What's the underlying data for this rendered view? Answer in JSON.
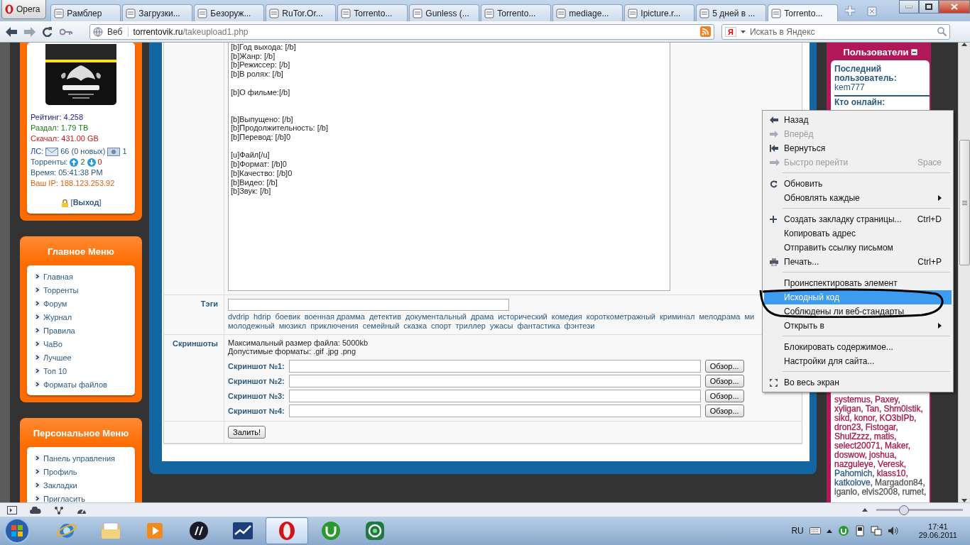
{
  "browser": {
    "opera_button": "Opera",
    "tabs": [
      {
        "title": "Рамблер",
        "selected": false
      },
      {
        "title": "Загрузки...",
        "selected": false
      },
      {
        "title": "Безоруж...",
        "selected": false
      },
      {
        "title": "RuTor.Or...",
        "selected": false
      },
      {
        "title": "Torrento...",
        "selected": false
      },
      {
        "title": "Gunless (...",
        "selected": false
      },
      {
        "title": "Torrento...",
        "selected": false
      },
      {
        "title": "mediage...",
        "selected": false
      },
      {
        "title": "Ipicture.r...",
        "selected": false
      },
      {
        "title": "5 дней в ...",
        "selected": false
      },
      {
        "title": "Torrento...",
        "selected": true
      }
    ],
    "address": {
      "scope": "Веб",
      "host": "torrentovik.ru",
      "path": "/takeupload1.php"
    },
    "search": {
      "engine": "Я",
      "placeholder": "Искать в Яндекс"
    }
  },
  "profile": {
    "stats": [
      {
        "label": "Рейтинг:",
        "value": "4.258",
        "color": "#1c1c8a"
      },
      {
        "label": "Раздал:",
        "value": "1.79 TB",
        "color": "#1f7a1f"
      },
      {
        "label": "Скачал:",
        "value": "431.00 GB",
        "color": "#c41a1a"
      }
    ],
    "messages": {
      "label": "ЛС:",
      "inbox": "66 (0 новых)",
      "outbox": "1"
    },
    "torrents": {
      "label": "Торренты:",
      "seeding": "2",
      "leeching": "0"
    },
    "time": "Время: 05:41:38 PM",
    "ip": "Ваш IP: 188.123.253.92",
    "logout": "[**Выход**]"
  },
  "main_menu": {
    "title": "Главное Меню",
    "items": [
      "Главная",
      "Торренты",
      "Форум",
      "Журнал",
      "Правила",
      "ЧаВо",
      "Лучшее",
      "Топ 10",
      "Форматы файлов"
    ]
  },
  "personal_menu": {
    "title": "Персональное Меню",
    "items": [
      "Панель управления",
      "Профиль",
      "Закладки",
      "Пригласить"
    ]
  },
  "upload_form": {
    "description": "[b]Год выхода: [/b]\n[b]Жанр: [/b]\n[b]Режиссер: [/b]\n[b]В ролях: [/b]\n\n[b]О фильме:[/b]\n\n\n[b]Выпущено: [/b]\n[b]Продолжительность: [/b]\n[b]Перевод: [/b]0\n\n[u]Файл[/u]\n[b]Формат: [/b]0\n[b]Качество: [/b]0\n[b]Видео: [/b]\n[b]Звук: [/b]",
    "tags": {
      "label": "Тэги",
      "lines": [
        [
          "dvdrip",
          "hdrip",
          "боевик",
          "военная драмма",
          "детектив",
          "документальный",
          "драма",
          "исторический",
          "комедия",
          "короткометражный",
          "криминал",
          "мелодрама",
          "ми"
        ],
        [
          "молодежный",
          "мюзикл",
          "приключения",
          "семейный",
          "сказка",
          "спорт",
          "триллер",
          "ужасы",
          "фантастика",
          "фэнтези"
        ]
      ]
    },
    "screenshots": {
      "label": "Скриншоты",
      "max_size": "Максимальный размер файла: 5000kb",
      "formats": "Допустимые форматы: .gif .jpg .png",
      "fields": [
        {
          "label": "Скриншот №1:",
          "button": "Обзор..."
        },
        {
          "label": "Скриншот №2:",
          "button": "Обзор..."
        },
        {
          "label": "Скриншот №3:",
          "button": "Обзор..."
        },
        {
          "label": "Скриншот №4:",
          "button": "Обзор..."
        }
      ]
    },
    "submit": "Залить!"
  },
  "users_panel": {
    "title": "Пользователи",
    "last_user_label": "Последний пользователь:",
    "last_user": "kem777",
    "online_label": "Кто онлайн:",
    "online": [
      {
        "name": "systemus,",
        "color": "#a8174a"
      },
      {
        "name": "Paxey,",
        "color": "#a8174a"
      },
      {
        "name": "xyligan,",
        "color": "#a8174a"
      },
      {
        "name": "Tan,",
        "color": "#a8174a"
      },
      {
        "name": "Shm0lstik,",
        "color": "#a8174a"
      },
      {
        "name": "sikd,",
        "color": "#a8174a"
      },
      {
        "name": "konor,",
        "color": "#a8174a"
      },
      {
        "name": "KO3bIPb,",
        "color": "#a8174a"
      },
      {
        "name": "dron23,",
        "color": "#a8174a"
      },
      {
        "name": "Fistogar,",
        "color": "#a8174a"
      },
      {
        "name": "ShulZzzz,",
        "color": "#a8174a"
      },
      {
        "name": "matis,",
        "color": "#a8174a"
      },
      {
        "name": "select20071,",
        "color": "#a8174a"
      },
      {
        "name": "Maker,",
        "color": "#a8174a"
      },
      {
        "name": "doswow,",
        "color": "#a8174a"
      },
      {
        "name": "joshua,",
        "color": "#a8174a"
      },
      {
        "name": "nazguleye,",
        "color": "#a8174a"
      },
      {
        "name": "Veresk,",
        "color": "#a8174a"
      },
      {
        "name": "Pahomich,",
        "color": "#2b5a86"
      },
      {
        "name": "klass10,",
        "color": "#a8174a"
      },
      {
        "name": "katkolove,",
        "color": "#2b5a86"
      },
      {
        "name": "Margadon84,",
        "color": "#555555"
      },
      {
        "name": "iganlo,",
        "color": "#555555"
      },
      {
        "name": "elvis2008,",
        "color": "#555555"
      },
      {
        "name": "rumet,",
        "color": "#555555"
      }
    ]
  },
  "context_menu": [
    {
      "kind": "item",
      "label": "Назад",
      "disabled": false,
      "selected": false,
      "submenu": false
    },
    {
      "kind": "item",
      "label": "Вперёд",
      "disabled": true,
      "selected": false,
      "submenu": false
    },
    {
      "kind": "item",
      "label": "Вернуться",
      "disabled": false,
      "selected": false,
      "submenu": false
    },
    {
      "kind": "item",
      "label": "Быстро перейти",
      "shortcut": "Space",
      "disabled": true,
      "selected": false,
      "submenu": false
    },
    {
      "kind": "separator"
    },
    {
      "kind": "item",
      "label": "Обновить",
      "disabled": false,
      "selected": false,
      "submenu": false
    },
    {
      "kind": "item",
      "label": "Обновлять каждые",
      "disabled": false,
      "selected": false,
      "submenu": true
    },
    {
      "kind": "separator"
    },
    {
      "kind": "item",
      "label": "Создать закладку страницы...",
      "shortcut": "Ctrl+D",
      "disabled": false,
      "selected": false,
      "submenu": false
    },
    {
      "kind": "item",
      "label": "Копировать адрес",
      "disabled": false,
      "selected": false,
      "submenu": false
    },
    {
      "kind": "item",
      "label": "Отправить ссылку письмом",
      "disabled": false,
      "selected": false,
      "submenu": false
    },
    {
      "kind": "item",
      "label": "Печать...",
      "shortcut": "Ctrl+P",
      "disabled": false,
      "selected": false,
      "submenu": false
    },
    {
      "kind": "separator"
    },
    {
      "kind": "item",
      "label": "Проинспектировать элемент",
      "disabled": false,
      "selected": false,
      "submenu": false
    },
    {
      "kind": "item",
      "label": "Исходный код",
      "disabled": false,
      "selected": true,
      "submenu": false
    },
    {
      "kind": "item",
      "label": "Соблюдены ли веб-стандарты",
      "disabled": false,
      "selected": false,
      "submenu": false
    },
    {
      "kind": "item",
      "label": "Открыть в",
      "disabled": false,
      "selected": false,
      "submenu": true
    },
    {
      "kind": "separator"
    },
    {
      "kind": "item",
      "label": "Блокировать содержимое...",
      "disabled": false,
      "selected": false,
      "submenu": false
    },
    {
      "kind": "item",
      "label": "Настройки для сайта...",
      "disabled": false,
      "selected": false,
      "submenu": false
    },
    {
      "kind": "separator"
    },
    {
      "kind": "item",
      "label": "Во весь экран",
      "disabled": false,
      "selected": false,
      "submenu": false
    }
  ],
  "status_bar": {
    "zoom": {
      "level": 0.32
    }
  },
  "taskbar": {
    "apps": [
      {
        "selected": false
      },
      {
        "selected": false
      },
      {
        "selected": false
      },
      {
        "selected": false
      },
      {
        "selected": false
      },
      {
        "selected": true
      },
      {
        "selected": false
      },
      {
        "selected": false
      }
    ],
    "tray": {
      "language": "RU",
      "time": "17:41",
      "date": "29.06.2011"
    }
  }
}
